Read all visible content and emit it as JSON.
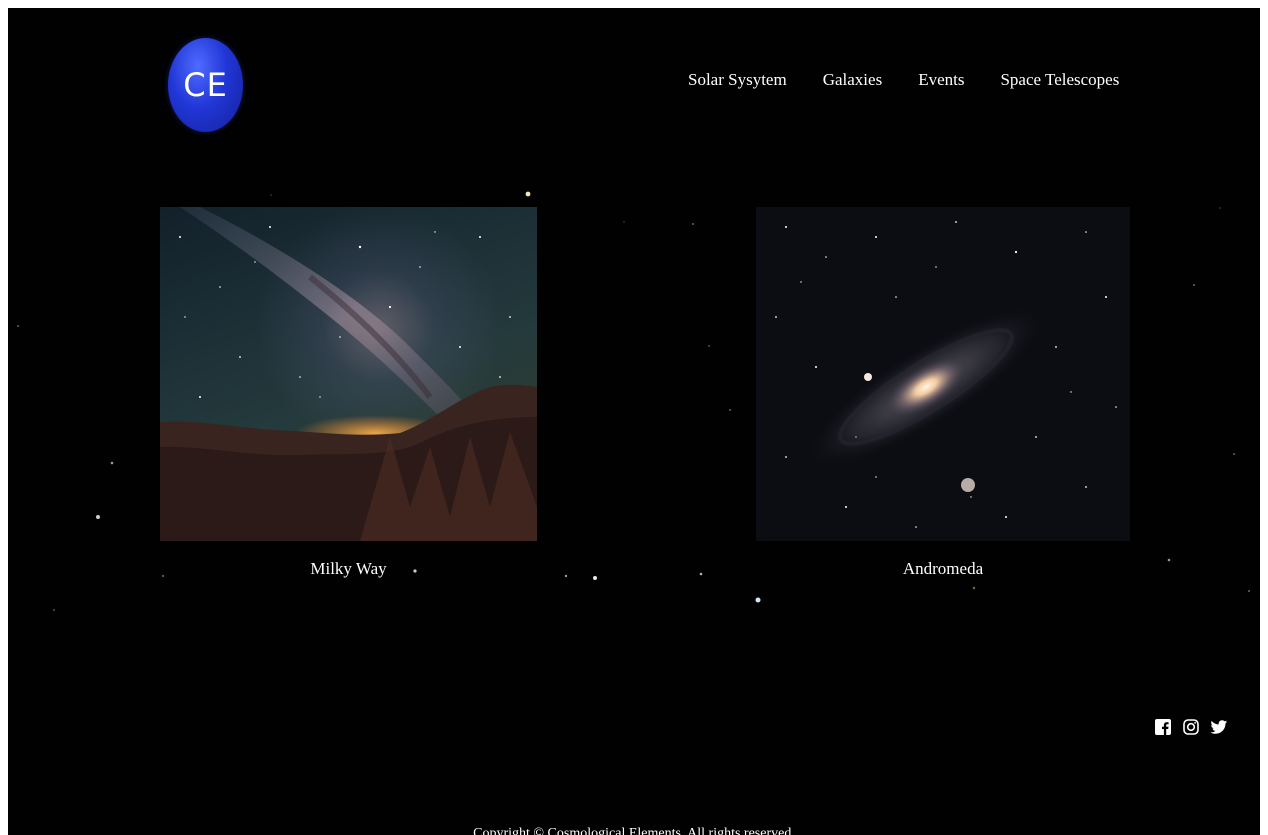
{
  "brand": {
    "logo_text": "CE"
  },
  "nav": {
    "items": [
      {
        "label": "Solar Sysytem"
      },
      {
        "label": "Galaxies"
      },
      {
        "label": "Events"
      },
      {
        "label": "Space Telescopes"
      }
    ]
  },
  "gallery": {
    "cards": [
      {
        "caption": "Milky Way",
        "image": "milky-way-photo"
      },
      {
        "caption": "Andromeda",
        "image": "andromeda-galaxy-photo"
      }
    ]
  },
  "social": {
    "icons": [
      "facebook-icon",
      "instagram-icon",
      "twitter-icon"
    ]
  },
  "footer": {
    "copyright": "Copyright © Cosmological Elements. All rights reserved."
  },
  "colors": {
    "background": "#010101",
    "logo_blue": "#2136d6",
    "text": "#ffffff"
  }
}
